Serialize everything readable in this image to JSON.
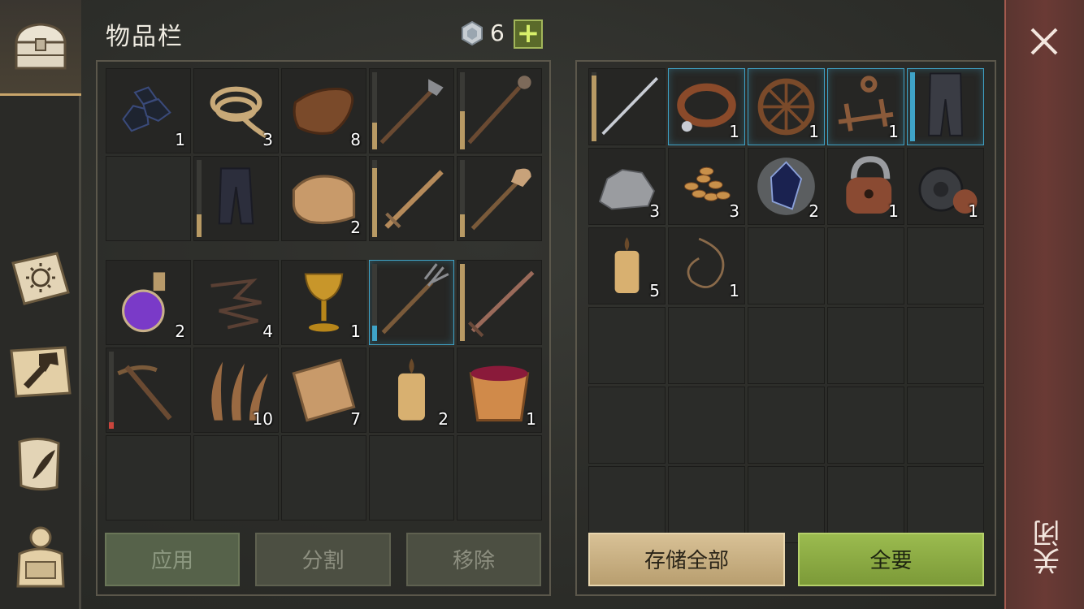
{
  "title": "物品栏",
  "currency": {
    "icon": "gem-icon",
    "count": "6",
    "add": "+"
  },
  "close": {
    "label": "关闭",
    "icon": "close-icon"
  },
  "left_grid": {
    "slots": [
      {
        "icon": "coal",
        "count": "1"
      },
      {
        "icon": "rope",
        "count": "3"
      },
      {
        "icon": "leather",
        "count": "8"
      },
      {
        "icon": "halberd",
        "count": "",
        "durability": 0.35,
        "durcolor": "#b89a64"
      },
      {
        "icon": "mace",
        "count": "",
        "durability": 0.5,
        "durcolor": "#b89a64"
      },
      {
        "icon": "",
        "count": ""
      },
      {
        "icon": "pants",
        "count": "",
        "durability": 0.3,
        "durcolor": "#b89a64"
      },
      {
        "icon": "cloth",
        "count": "2"
      },
      {
        "icon": "sword",
        "count": "",
        "durability": 0.9,
        "durcolor": "#b89a64"
      },
      {
        "icon": "shovel",
        "count": "",
        "durability": 0.3,
        "durcolor": "#b89a64"
      },
      {
        "icon": "potion",
        "count": "2"
      },
      {
        "icon": "wire",
        "count": "4"
      },
      {
        "icon": "goblet",
        "count": "1"
      },
      {
        "icon": "pitchfork",
        "count": "",
        "durability": 0.2,
        "durcolor": "#3fa3c7",
        "sel": true
      },
      {
        "icon": "longsword",
        "count": "",
        "durability": 1.0,
        "durcolor": "#b89a64"
      },
      {
        "icon": "crossbow",
        "count": "",
        "durability": 0.08,
        "durcolor": "#c9453c"
      },
      {
        "icon": "fibers",
        "count": "10"
      },
      {
        "icon": "cloth2",
        "count": "7"
      },
      {
        "icon": "candle",
        "count": "2"
      },
      {
        "icon": "bucket",
        "count": "1"
      },
      {
        "icon": "",
        "count": ""
      },
      {
        "icon": "",
        "count": ""
      },
      {
        "icon": "",
        "count": ""
      },
      {
        "icon": "",
        "count": ""
      },
      {
        "icon": "",
        "count": ""
      }
    ]
  },
  "right_grid": {
    "slots": [
      {
        "icon": "longsword2",
        "count": "",
        "durability": 0.95,
        "durcolor": "#b89a64"
      },
      {
        "icon": "collar",
        "count": "1",
        "sel": true
      },
      {
        "icon": "wheel",
        "count": "1",
        "sel": true
      },
      {
        "icon": "device",
        "count": "1",
        "sel": true
      },
      {
        "icon": "chainpants",
        "count": "",
        "durability": 1.0,
        "durcolor": "#3fa3c7",
        "sel": true
      },
      {
        "icon": "stone",
        "count": "3"
      },
      {
        "icon": "seeds",
        "count": "3"
      },
      {
        "icon": "crystal",
        "count": "2"
      },
      {
        "icon": "lock",
        "count": "1"
      },
      {
        "icon": "gears",
        "count": "1"
      },
      {
        "icon": "candle",
        "count": "5"
      },
      {
        "icon": "whip",
        "count": "1"
      },
      {
        "icon": "",
        "count": ""
      },
      {
        "icon": "",
        "count": ""
      },
      {
        "icon": "",
        "count": ""
      },
      {
        "icon": "",
        "count": ""
      },
      {
        "icon": "",
        "count": ""
      },
      {
        "icon": "",
        "count": ""
      },
      {
        "icon": "",
        "count": ""
      },
      {
        "icon": "",
        "count": ""
      },
      {
        "icon": "",
        "count": ""
      },
      {
        "icon": "",
        "count": ""
      },
      {
        "icon": "",
        "count": ""
      },
      {
        "icon": "",
        "count": ""
      },
      {
        "icon": "",
        "count": ""
      },
      {
        "icon": "",
        "count": ""
      },
      {
        "icon": "",
        "count": ""
      },
      {
        "icon": "",
        "count": ""
      },
      {
        "icon": "",
        "count": ""
      },
      {
        "icon": "",
        "count": ""
      }
    ]
  },
  "buttons": {
    "apply": "应用",
    "split": "分割",
    "remove": "移除",
    "store_all": "存储全部",
    "take_all": "全要"
  },
  "rail": [
    "chest-icon",
    "sun-book-icon",
    "hammer-map-icon",
    "scroll-quill-icon",
    "backpack-icon"
  ]
}
